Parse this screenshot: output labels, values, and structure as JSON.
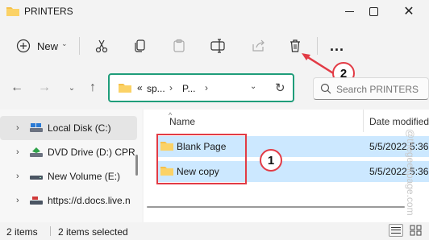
{
  "window": {
    "title": "PRINTERS"
  },
  "toolbar": {
    "new_label": "New",
    "more_label": "..."
  },
  "address": {
    "overflow": "«",
    "crumbs": [
      "sp...",
      "P..."
    ]
  },
  "search": {
    "placeholder": "Search PRINTERS"
  },
  "nav": {
    "items": [
      {
        "label": "Local Disk (C:)",
        "icon": "hard-drive-icon",
        "selected": true
      },
      {
        "label": "DVD Drive (D:) CPR",
        "icon": "dvd-drive-icon",
        "selected": false
      },
      {
        "label": "New Volume (E:)",
        "icon": "drive-icon",
        "selected": false
      },
      {
        "label": "https://d.docs.live.n",
        "icon": "network-drive-icon",
        "selected": false
      }
    ]
  },
  "table": {
    "columns": {
      "name": "Name",
      "date": "Date modified"
    },
    "rows": [
      {
        "name": "Blank Page",
        "date": "5/5/2022 5:36"
      },
      {
        "name": "New copy",
        "date": "5/5/2022 5:36"
      }
    ]
  },
  "callouts": {
    "one": "1",
    "two": "2"
  },
  "watermark": "@thegeekpage.com",
  "status": {
    "items": "2 items",
    "selected": "2 items selected"
  },
  "colors": {
    "highlight_box": "#e23b45",
    "address_box": "#1f9d7a",
    "selection": "#cce8ff"
  }
}
